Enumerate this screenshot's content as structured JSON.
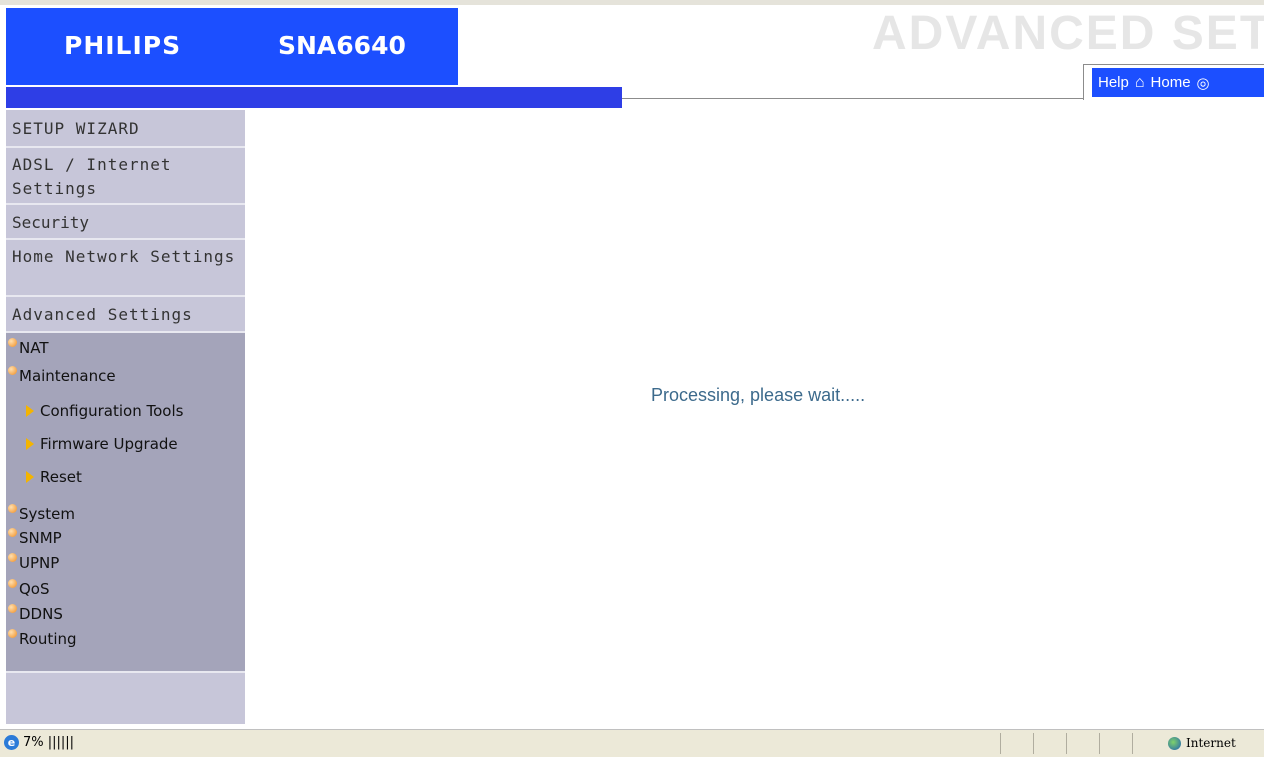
{
  "header": {
    "brand": "PHILIPS",
    "model": "SNA6640",
    "section_title": "ADVANCED SET",
    "help_label": "Help",
    "home_label": "Home"
  },
  "sidebar": {
    "menu": [
      {
        "label": "SETUP WIZARD"
      },
      {
        "label": "ADSL / Internet Settings"
      },
      {
        "label": "Security"
      },
      {
        "label": "Home Network Settings"
      },
      {
        "label": "Advanced Settings"
      }
    ],
    "submenu": {
      "nat": "NAT",
      "maintenance": "Maintenance",
      "maintenance_children": [
        "Configuration Tools",
        "Firmware Upgrade",
        "Reset"
      ],
      "system": "System",
      "snmp": "SNMP",
      "upnp": "UPNP",
      "qos": "QoS",
      "ddns": "DDNS",
      "routing": "Routing"
    }
  },
  "main": {
    "message": "Processing, please wait....."
  },
  "statusbar": {
    "progress": "7% ||||||",
    "zone": "Internet"
  },
  "colors": {
    "brand_blue": "#1c4fff",
    "strip_blue": "#2e3ee6",
    "sidebar_bg": "#c7c6d9",
    "submenu_bg": "#a4a4ba",
    "message_text": "#3c6a8c"
  }
}
